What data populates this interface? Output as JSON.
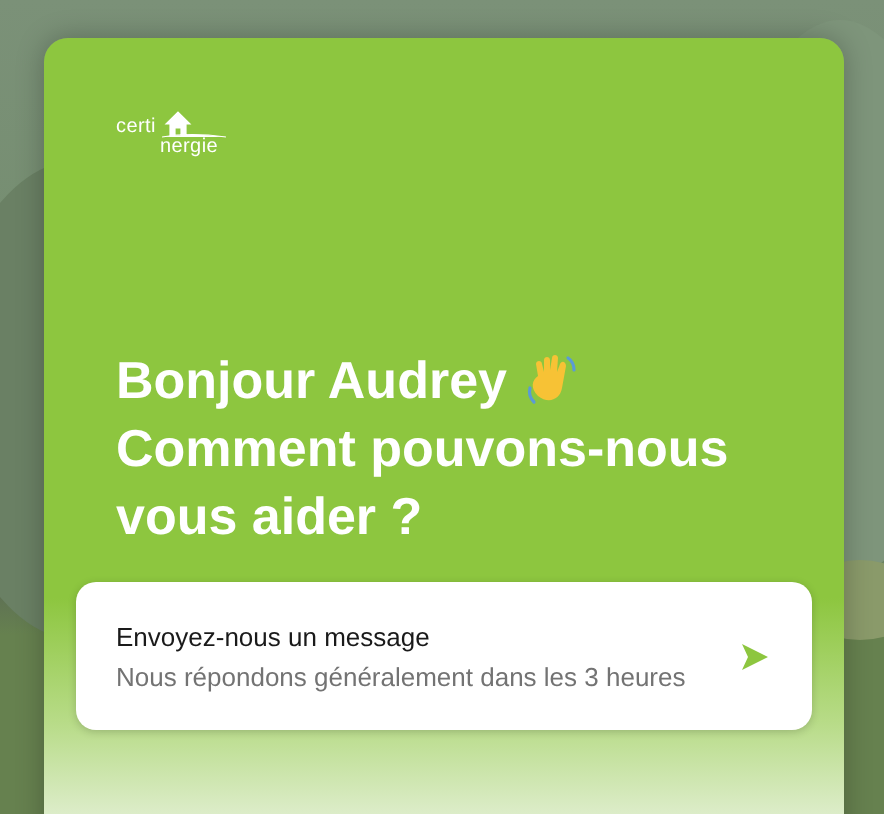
{
  "logo": {
    "line_1": "certi",
    "line_2": "nergie"
  },
  "heading": {
    "greeting": "Bonjour Audrey",
    "question": "Comment pouvons-nous vous aider ?"
  },
  "message_card": {
    "title": "Envoyez-nous un message",
    "subtitle": "Nous répondons généralement dans les 3 heures"
  }
}
